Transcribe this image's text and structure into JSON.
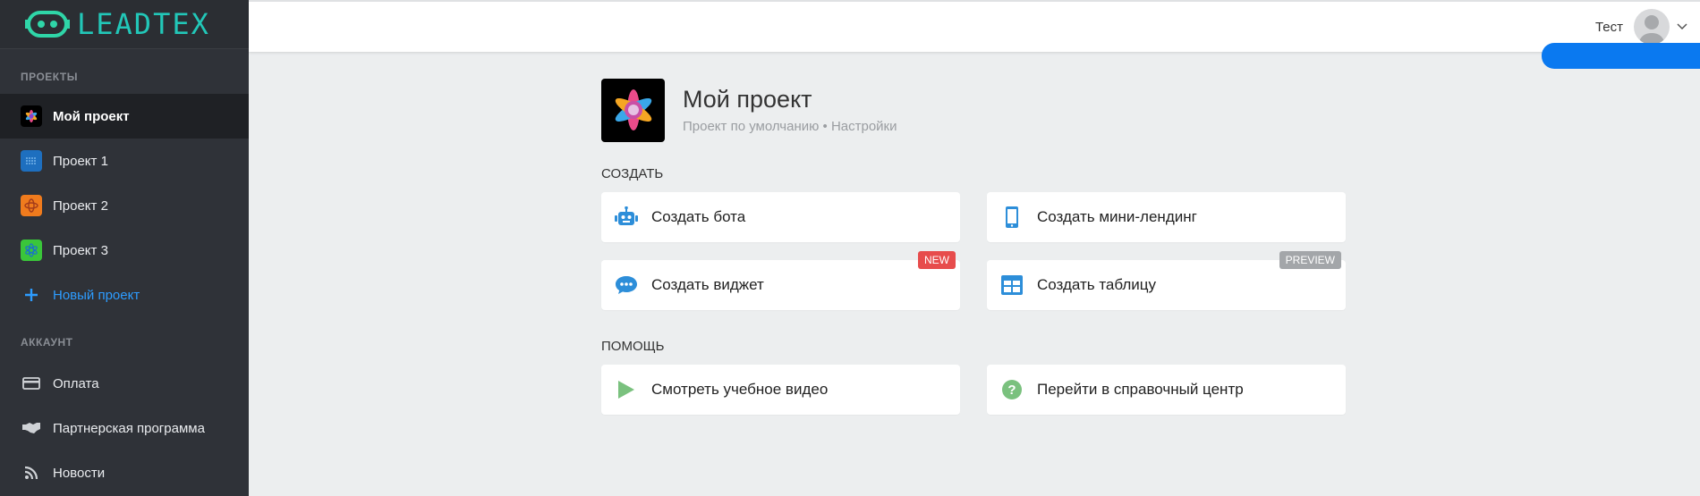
{
  "app": {
    "logo_text": "LEADTEX"
  },
  "sidebar": {
    "projects_title": "ПРОЕКТЫ",
    "projects": [
      {
        "label": "Мой проект",
        "active": true,
        "icon": "flower-icon",
        "color": "#000000"
      },
      {
        "label": "Проект 1",
        "icon": "pattern-icon",
        "color": "#1e6fbf"
      },
      {
        "label": "Проект 2",
        "icon": "pattern-icon",
        "color": "#f07b1d"
      },
      {
        "label": "Проект 3",
        "icon": "pattern-icon",
        "color": "#3ac63a"
      }
    ],
    "new_project": "Новый проект",
    "account_title": "АККАУНТ",
    "account": [
      {
        "label": "Оплата",
        "icon": "credit-card-icon"
      },
      {
        "label": "Партнерская программа",
        "icon": "handshake-icon"
      },
      {
        "label": "Новости",
        "icon": "rss-icon"
      }
    ]
  },
  "topbar": {
    "user_name": "Тест"
  },
  "project": {
    "title": "Мой проект",
    "subtitle": "Проект по умолчанию • Настройки"
  },
  "create": {
    "title": "СОЗДАТЬ",
    "cards": [
      {
        "label": "Создать бота",
        "icon": "robot-icon"
      },
      {
        "label": "Создать мини-лендинг",
        "icon": "mobile-icon"
      },
      {
        "label": "Создать виджет",
        "icon": "chat-icon",
        "badge": "NEW"
      },
      {
        "label": "Создать таблицу",
        "icon": "table-icon",
        "badge": "PREVIEW"
      }
    ]
  },
  "help": {
    "title": "ПОМОЩЬ",
    "cards": [
      {
        "label": "Смотреть учебное видео",
        "icon": "play-icon"
      },
      {
        "label": "Перейти в справочный центр",
        "icon": "help-circle-icon"
      }
    ]
  },
  "colors": {
    "accent": "#2d9cff",
    "sidebar": "#2f3238",
    "help_green": "#7ac17e"
  }
}
